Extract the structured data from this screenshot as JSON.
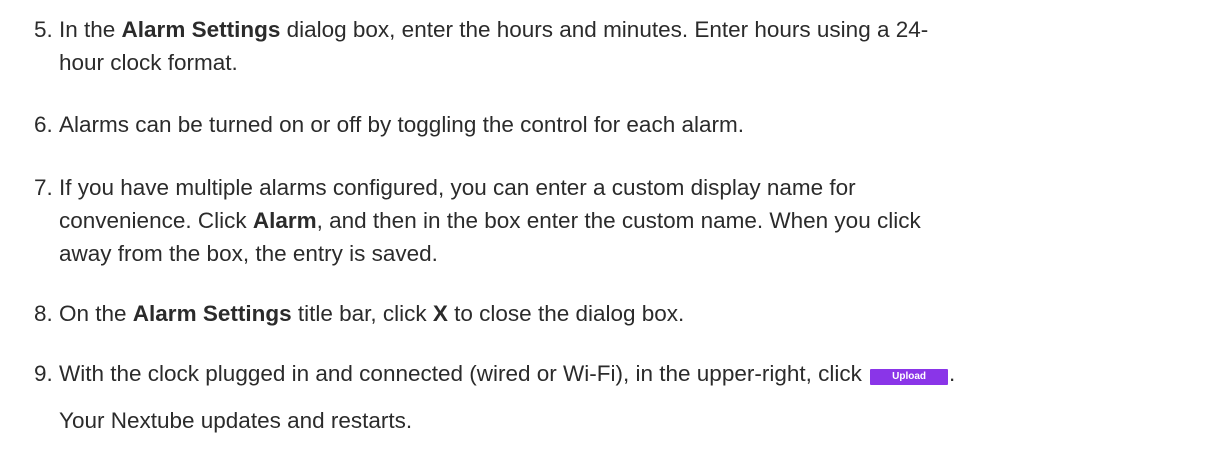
{
  "steps": [
    {
      "number": "5.",
      "lines": [
        {
          "a": "In the ",
          "b": "Alarm Settings",
          "c": " dialog box, enter the hours and minutes. Enter hours using a 24-"
        },
        {
          "a": "hour clock format."
        }
      ]
    },
    {
      "number": "6.",
      "lines": [
        {
          "a": "Alarms can be turned on or off by toggling the control for each alarm."
        }
      ]
    },
    {
      "number": "7.",
      "lines": [
        {
          "a": "If you have multiple alarms configured, you can enter a custom display name for"
        },
        {
          "a": "convenience. Click ",
          "b": "Alarm",
          "c": ", and then in the box enter the custom name. When you click"
        },
        {
          "a": "away from the box, the entry is saved."
        }
      ]
    },
    {
      "number": "8.",
      "lines": [
        {
          "a": "On the ",
          "b": "Alarm Settings",
          "c": " title bar, click ",
          "d": "X",
          "e": " to close the dialog box."
        }
      ]
    },
    {
      "number": "9.",
      "lines": [
        {
          "a": "With the clock plugged in and connected (wired or Wi-Fi), in the upper-right, click ",
          "button": "Upload",
          "c": "."
        }
      ],
      "result": "Your Nextube updates and restarts."
    }
  ],
  "colors": {
    "text": "#2b2b2b",
    "upload_button": "#8a35e8"
  }
}
